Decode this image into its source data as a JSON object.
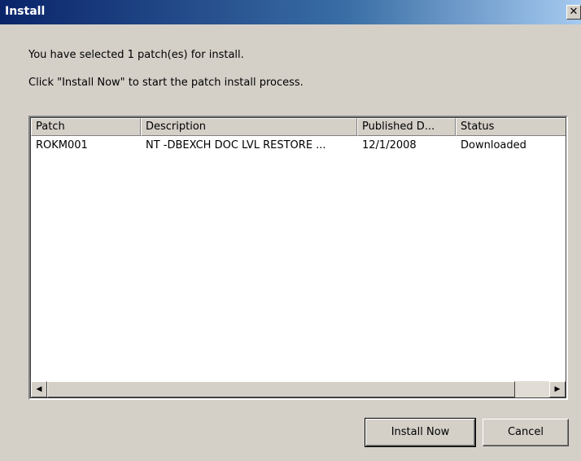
{
  "window": {
    "title": "Install",
    "close_glyph": "✕"
  },
  "messages": {
    "line1": "You have selected 1 patch(es) for install.",
    "line2": "Click \"Install Now\" to start the patch install process."
  },
  "table": {
    "columns": [
      "Patch",
      "Description",
      "Published D...",
      "Status"
    ],
    "rows": [
      [
        "ROKM001",
        "NT -DBEXCH DOC LVL RESTORE ...",
        "12/1/2008",
        "Downloaded"
      ]
    ]
  },
  "scrollbar": {
    "left_arrow": "◀",
    "right_arrow": "▶"
  },
  "buttons": {
    "install_now": "Install Now",
    "cancel": "Cancel"
  }
}
